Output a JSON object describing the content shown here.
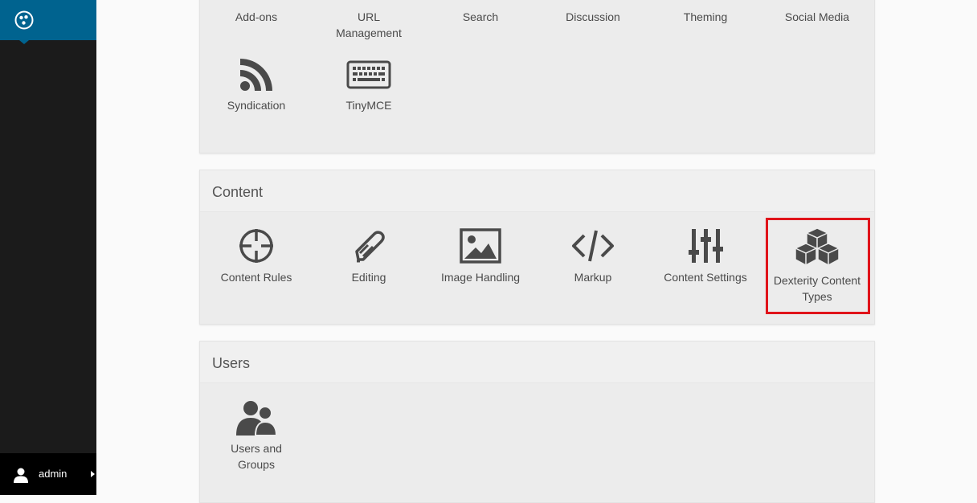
{
  "sidebar": {
    "logo_icon": "plone-logo-icon",
    "user": {
      "name": "admin",
      "icon": "user-icon"
    }
  },
  "general_panel": {
    "items": [
      {
        "label": "Add-ons",
        "icon": "none"
      },
      {
        "label": "URL Management",
        "icon": "none"
      },
      {
        "label": "Search",
        "icon": "none"
      },
      {
        "label": "Discussion",
        "icon": "none"
      },
      {
        "label": "Theming",
        "icon": "none"
      },
      {
        "label": "Social Media",
        "icon": "none"
      },
      {
        "label": "Syndication",
        "icon": "rss-icon"
      },
      {
        "label": "TinyMCE",
        "icon": "keyboard-icon"
      }
    ]
  },
  "content_panel": {
    "title": "Content",
    "items": [
      {
        "label": "Content Rules",
        "icon": "crosshair-icon"
      },
      {
        "label": "Editing",
        "icon": "pencil-icon"
      },
      {
        "label": "Image Handling",
        "icon": "image-icon"
      },
      {
        "label": "Markup",
        "icon": "code-icon"
      },
      {
        "label": "Content Settings",
        "icon": "sliders-icon"
      },
      {
        "label": "Dexterity Content Types",
        "icon": "cubes-icon"
      }
    ]
  },
  "users_panel": {
    "title": "Users",
    "items": [
      {
        "label": "Users and Groups",
        "icon": "users-icon"
      }
    ]
  },
  "colors": {
    "accent": "#00638f",
    "highlight": "#e0131a",
    "sidebar": "#1b1b1b"
  }
}
